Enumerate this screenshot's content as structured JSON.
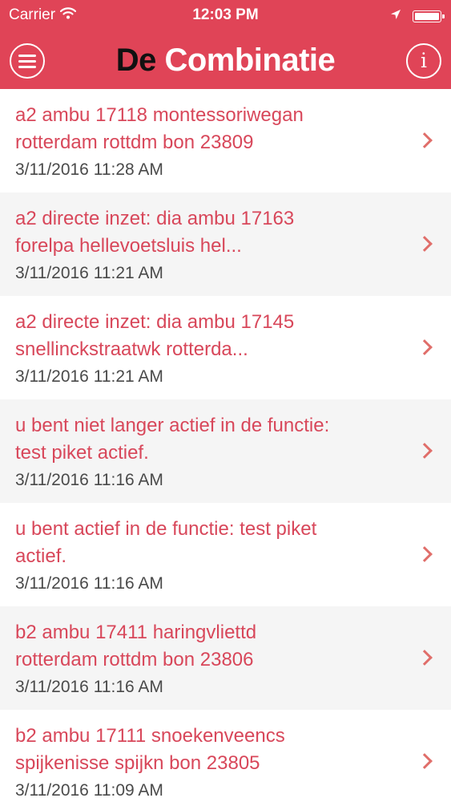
{
  "status_bar": {
    "carrier": "Carrier",
    "time": "12:03 PM",
    "icons": [
      "wifi-icon",
      "location-arrow-icon",
      "battery-icon"
    ]
  },
  "nav": {
    "title_part1": "De",
    "title_part2": "Combinatie",
    "left_icon": "menu-icon",
    "right_icon": "info-icon",
    "info_glyph": "i"
  },
  "colors": {
    "header_bg": "#e04457",
    "title_text": "#d8475a",
    "chevron": "#e06e6a",
    "timestamp": "#4a4a4a",
    "row_alt_bg": "#f5f5f5"
  },
  "messages": [
    {
      "line1": "a2 ambu 17118 montessoriwegan",
      "line2": "rotterdam rottdm bon 23809",
      "time": "3/11/2016 11:28 AM"
    },
    {
      "line1": "a2 directe inzet: dia ambu 17163",
      "line2": "forelpa hellevoetsluis hel...",
      "time": "3/11/2016 11:21 AM"
    },
    {
      "line1": "a2 directe inzet: dia ambu 17145",
      "line2": "snellinckstraatwk rotterda...",
      "time": "3/11/2016 11:21 AM"
    },
    {
      "line1": "u bent niet langer actief in de functie:",
      "line2": "test piket actief.",
      "time": "3/11/2016 11:16 AM"
    },
    {
      "line1": "u bent actief in de functie: test piket",
      "line2": "actief.",
      "time": "3/11/2016 11:16 AM"
    },
    {
      "line1": "b2 ambu 17411 haringvliettd",
      "line2": "rotterdam rottdm bon 23806",
      "time": "3/11/2016 11:16 AM"
    },
    {
      "line1": "b2 ambu 17111 snoekenveencs",
      "line2": "spijkenisse spijkn bon 23805",
      "time": "3/11/2016 11:09 AM"
    }
  ]
}
